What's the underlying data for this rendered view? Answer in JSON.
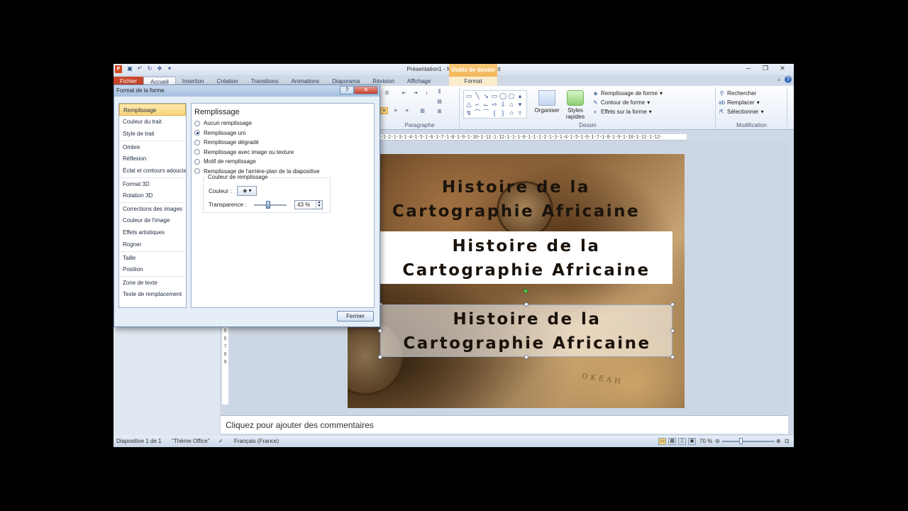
{
  "window": {
    "title": "Présentation1 - Microsoft PowerPoint",
    "app_icon": "P",
    "contextual_tab": "Outils de dessin",
    "controls": [
      "─",
      "❐",
      "✕"
    ]
  },
  "tabs": {
    "file": "Fichier",
    "home": "Accueil",
    "insert": "Insertion",
    "design": "Création",
    "transitions": "Transitions",
    "animations": "Animations",
    "slideshow": "Diaporama",
    "review": "Révision",
    "view": "Affichage",
    "format": "Format"
  },
  "ribbon": {
    "paragraph_label": "Paragraphe",
    "drawing_label": "Dessin",
    "editing_label": "Modification",
    "arrange": "Organiser",
    "quick_styles_1": "Styles",
    "quick_styles_2": "rapides",
    "shape_fill": "Remplissage de forme",
    "shape_outline": "Contour de forme",
    "shape_effects": "Effets sur la forme",
    "find": "Rechercher",
    "replace": "Remplacer",
    "select": "Sélectionner"
  },
  "ruler": {
    "top": "·1·2·1·3·1·4·1·5·1·6·1·7·1·8·1·9·1·10·1·11·1·12·1·1·1·0·1·1·1·2·1·3·1·4·1·5·1·6·1·7·1·8·1·9·1·10·1·11·1·12·",
    "left": [
      "4",
      "5",
      "6",
      "7",
      "8",
      "9"
    ]
  },
  "dialog": {
    "title": "Format de la forme",
    "help": "?",
    "close": "✕",
    "categories": [
      "Remplissage",
      "Couleur du trait",
      "Style de trait",
      "Ombre",
      "Réflexion",
      "Éclat et contours adoucis",
      "Format 3D",
      "Rotation 3D",
      "Corrections des images",
      "Couleur de l'image",
      "Effets artistiques",
      "Rogner",
      "Taille",
      "Position",
      "Zone de texte",
      "Texte de remplacement"
    ],
    "panel_title": "Remplissage",
    "options": [
      "Aucun remplissage",
      "Remplissage uni",
      "Remplissage dégradé",
      "Remplissage avec image ou texture",
      "Motif de remplissage",
      "Remplissage de l'arrière-plan de la diapositive"
    ],
    "selected_option": "Remplissage uni",
    "fill_group_label": "Couleur de remplissage",
    "color_label": "Couleur :",
    "transparency_label": "Transparence :",
    "transparency_value": "43 %",
    "transparency_fraction": 0.43,
    "close_button": "Fermer"
  },
  "slide": {
    "title_line1": "Histoire de la",
    "title_line2": "Cartographie Africaine",
    "map_text": "OKEAH"
  },
  "comments_placeholder": "Cliquez pour ajouter des commentaires",
  "status": {
    "slide_info": "Diapositive 1 de 1",
    "theme": "\"Thème Office\"",
    "language": "Français (France)",
    "zoom": "70 %"
  },
  "colors": {
    "file_tab": "#c9452b",
    "contextual_tab": "#f0a946",
    "selection_highlight": "#f9d57a"
  }
}
